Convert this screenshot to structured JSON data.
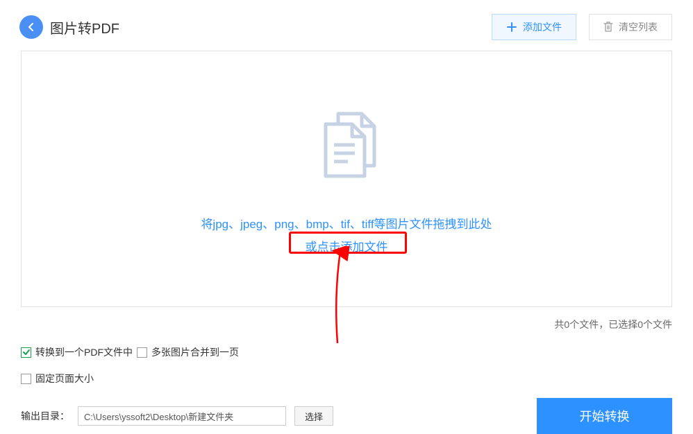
{
  "header": {
    "title": "图片转PDF",
    "add_file_btn": "添加文件",
    "clear_list_btn": "清空列表"
  },
  "dropzone": {
    "instruction": "将jpg、jpeg、png、bmp、tif、tiff等图片文件拖拽到此处",
    "link_text": "或点击添加文件"
  },
  "status": {
    "file_count_text": "共0个文件，已选择0个文件"
  },
  "options": {
    "merge_to_one_pdf": "转换到一个PDF文件中",
    "merge_images_to_page": "多张图片合并到一页",
    "merge_checked": true,
    "images_merge_checked": false,
    "fixed_page_size": "固定页面大小",
    "fixed_size_checked": false
  },
  "footer": {
    "output_dir_label": "输出目录：",
    "output_path": "C:\\Users\\yssoft2\\Desktop\\新建文件夹",
    "select_btn": "选择",
    "start_btn": "开始转换"
  }
}
